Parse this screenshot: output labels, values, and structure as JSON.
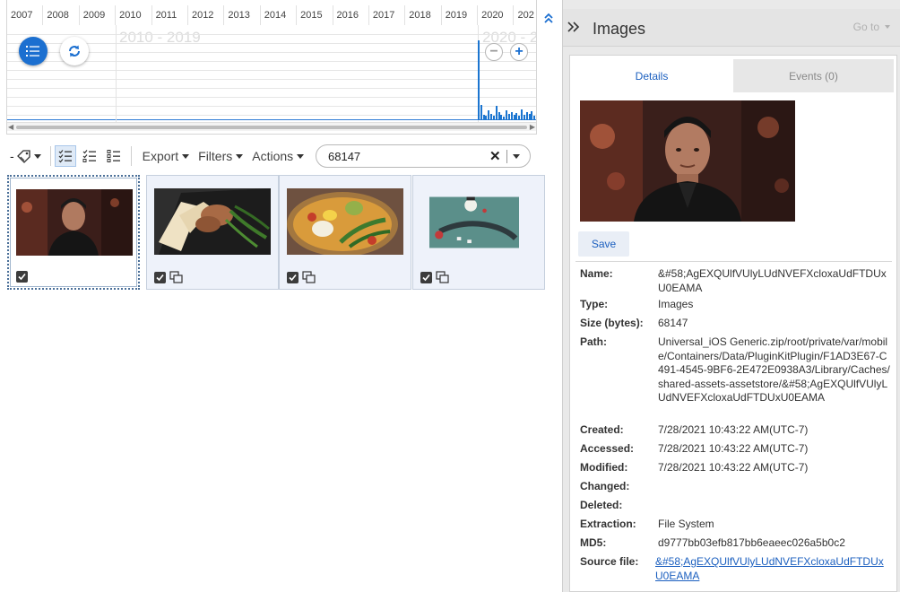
{
  "timeline": {
    "years": [
      "2007",
      "2008",
      "2009",
      "2010",
      "2011",
      "2012",
      "2013",
      "2014",
      "2015",
      "2016",
      "2017",
      "2018",
      "2019",
      "2020",
      "202"
    ],
    "decade_labels": [
      "2010 - 2019",
      "2020 - 2"
    ],
    "bar_levels": [
      0.97,
      0.18,
      0.06,
      0.05,
      0.12,
      0.08,
      0.05,
      0.17,
      0.1,
      0.06,
      0.04,
      0.12,
      0.08,
      0.1,
      0.06,
      0.09,
      0.05,
      0.13,
      0.07,
      0.1,
      0.08,
      0.11,
      0.05
    ]
  },
  "toolbar": {
    "export_label": "Export",
    "filters_label": "Filters",
    "actions_label": "Actions",
    "search_value": "68147"
  },
  "thumbnails": [
    {
      "name": "portrait",
      "selected": true,
      "duplicate": false
    },
    {
      "name": "chicken-plate",
      "selected": false,
      "duplicate": true
    },
    {
      "name": "salad-bowl",
      "selected": false,
      "duplicate": true
    },
    {
      "name": "illustration",
      "selected": false,
      "duplicate": true
    }
  ],
  "details": {
    "title": "Images",
    "goto_label": "Go to",
    "tab_details": "Details",
    "tab_events": "Events (0)",
    "save_label": "Save",
    "fields": {
      "name_label": "Name:",
      "name_value": "&#58;AgEXQUlfVUlyLUdNVEFXcloxaUdFTDUxU0EAMA",
      "type_label": "Type:",
      "type_value": "Images",
      "size_label": "Size (bytes):",
      "size_value": "68147",
      "path_label": "Path:",
      "path_value": "Universal_iOS Generic.zip/root/private/var/mobile/Containers/Data/PluginKitPlugin/F1AD3E67-C491-4545-9BF6-2E472E0938A3/Library/Caches/shared-assets-assetstore/&#58;AgEXQUlfVUlyLUdNVEFXcloxaUdFTDUxU0EAMA",
      "created_label": "Created:",
      "created_value": "7/28/2021 10:43:22 AM(UTC-7)",
      "accessed_label": "Accessed:",
      "accessed_value": "7/28/2021 10:43:22 AM(UTC-7)",
      "modified_label": "Modified:",
      "modified_value": "7/28/2021 10:43:22 AM(UTC-7)",
      "changed_label": "Changed:",
      "changed_value": "",
      "deleted_label": "Deleted:",
      "deleted_value": "",
      "extraction_label": "Extraction:",
      "extraction_value": "File System",
      "md5_label": "MD5:",
      "md5_value": "d9777bb03efb817bb6eaeec026a5b0c2",
      "source_label": "Source file:",
      "source_value": "&#58;AgEXQUlfVUlyLUdNVEFXcloxaUdFTDUxU0EAMA"
    }
  },
  "colors": {
    "accent": "#1b6fd0",
    "link": "#1b5fbf",
    "panel_bg": "#e9e9e9"
  },
  "icons": [
    "list-view-icon",
    "refresh-icon",
    "zoom-out-icon",
    "zoom-in-icon",
    "collapse-up-icon",
    "tag-icon",
    "checklist-view-icon",
    "checklist-alt-view-icon",
    "details-list-view-icon",
    "clear-icon",
    "chevron-down-icon",
    "checkbox-icon",
    "duplicate-icon",
    "expand-panel-icon"
  ]
}
